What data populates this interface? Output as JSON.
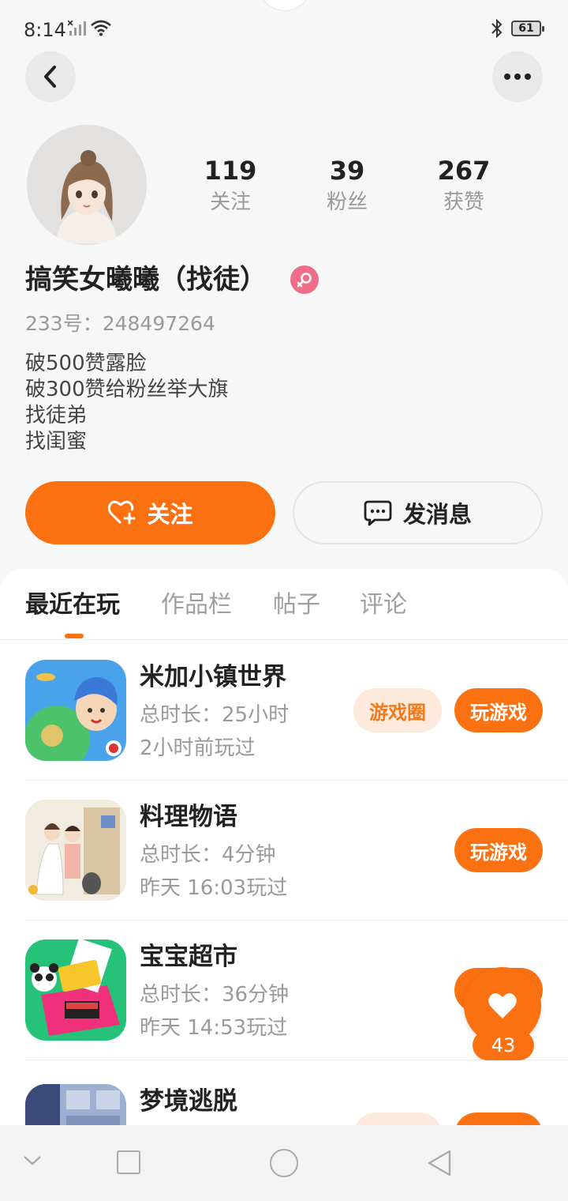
{
  "status": {
    "time": "8:14",
    "battery": "61"
  },
  "profile": {
    "stats": [
      {
        "num": "119",
        "label": "关注"
      },
      {
        "num": "39",
        "label": "粉丝"
      },
      {
        "num": "267",
        "label": "获赞"
      }
    ],
    "name": "搞笑女曦曦（找徒）",
    "uid": "233号：248497264",
    "bio": [
      "破500赞露脸",
      "破300赞给粉丝举大旗",
      "找徒弟",
      "找闺蜜"
    ]
  },
  "actions": {
    "follow": "关注",
    "message": "发消息"
  },
  "tabs": [
    "最近在玩",
    "作品栏",
    "帖子",
    "评论"
  ],
  "games": [
    {
      "title": "米加小镇世界",
      "duration": "总时长：25小时",
      "last_played": "2小时前玩过",
      "circle_label": "游戏圈",
      "play_label": "玩游戏"
    },
    {
      "title": "料理物语",
      "duration": "总时长：4分钟",
      "last_played": "昨天 16:03玩过",
      "play_label": "玩游戏"
    },
    {
      "title": "宝宝超市",
      "duration": "总时长：36分钟",
      "last_played": "昨天 14:53玩过",
      "play_label": "玩游戏"
    },
    {
      "title": "梦境逃脱"
    }
  ],
  "like_fab": {
    "count": "43"
  },
  "colors": {
    "accent": "#fb7112",
    "gender_badge": "#f06d8a",
    "circle_tag_bg": "#fdeadc"
  }
}
